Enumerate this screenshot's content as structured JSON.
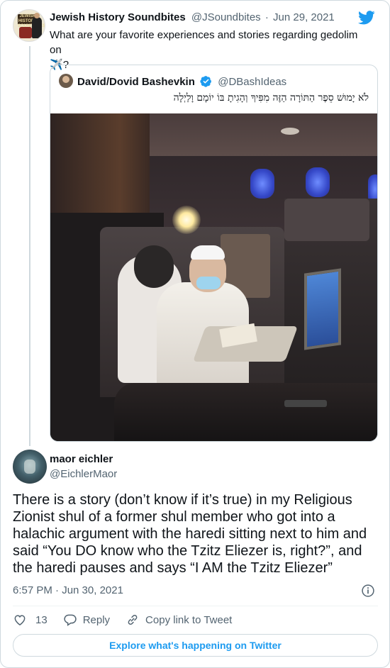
{
  "parent_tweet": {
    "avatar_logo_text": "JEWISH HISTORY SOUNDBITES",
    "author_name": "Jewish History Soundbites",
    "handle": "@JSoundbites",
    "separator": "·",
    "date": "Jun 29, 2021",
    "text": "What are your favorite experiences and stories regarding gedolim on",
    "emoji": "✈️",
    "text_end": "?"
  },
  "quoted_tweet": {
    "author_name": "David/Dovid Bashevkin",
    "handle": "@DBashIdeas",
    "text": "לֹא יָמוּשׁ סֵפֶר הַתּוֹרָה הַזֶּה מִפִּיךָ וְהָגִיתָ בּוֹ יוֹמָם וָלַיְלָה"
  },
  "reply_tweet": {
    "author_name": "maor eichler",
    "handle": "@EichlerMaor",
    "text": "There is a story (don’t know if it’s true) in my Religious Zionist shul of a former shul member who got into a halachic argument with the haredi sitting next to him and said “You DO know who the Tzitz Eliezer is, right?”, and the haredi pauses and says “I AM the Tzitz Eliezer”",
    "timestamp": "6:57 PM · Jun 30, 2021"
  },
  "actions": {
    "like_count": "13",
    "reply_label": "Reply",
    "copy_link_label": "Copy link to Tweet"
  },
  "explore_button": "Explore what's happening on Twitter",
  "colors": {
    "brand_blue": "#1d9bf0",
    "text_primary": "#0f1419",
    "text_secondary": "#536471",
    "border": "#cfd9de"
  },
  "icons": [
    "twitter-bird-icon",
    "verified-badge-icon",
    "info-icon",
    "heart-icon",
    "reply-icon",
    "link-icon"
  ]
}
